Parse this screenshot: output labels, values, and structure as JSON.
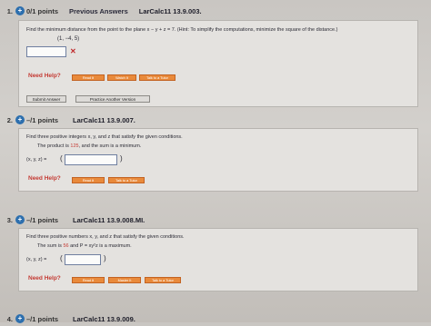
{
  "questions": [
    {
      "number": "1.",
      "points": "0/1 points",
      "previous_answers": "Previous Answers",
      "id": "LarCalc11 13.9.003.",
      "prompt": "Find the minimum distance from the point to the plane x − y + z = 7. (Hint: To simplify the computations, minimize the square of the distance.)",
      "point": "(1, −4, 5)",
      "answer_value": "",
      "wrong_mark": "✕",
      "need_help": "Need Help?",
      "help_buttons": [
        "Read It",
        "Watch It",
        "Talk to a Tutor"
      ],
      "submit": "Submit Answer",
      "practice": "Practice Another Version"
    },
    {
      "number": "2.",
      "points": "–/1 points",
      "id": "LarCalc11 13.9.007.",
      "prompt": "Find three positive integers x, y, and z that satisfy the given conditions.",
      "condition_pre": "The product is ",
      "condition_value": "125",
      "condition_post": ", and the sum is a minimum.",
      "answer_label": "(x, y, z) =",
      "open_paren": "(",
      "close_paren": ")",
      "answer_value": "",
      "need_help": "Need Help?",
      "help_buttons": [
        "Read It",
        "Talk to a Tutor"
      ]
    },
    {
      "number": "3.",
      "points": "–/1 points",
      "id": "LarCalc11 13.9.008.MI.",
      "prompt": "Find three positive numbers x, y, and z that satisfy the given conditions.",
      "condition_pre": "The sum is ",
      "condition_value": "56",
      "condition_post": " and P = xy²z is a maximum.",
      "answer_label": "(x, y, z) =",
      "open_paren": "(",
      "close_paren": ")",
      "answer_value": "",
      "need_help": "Need Help?",
      "help_buttons": [
        "Read It",
        "Master It",
        "Talk to a Tutor"
      ]
    },
    {
      "number": "4.",
      "points": "–/1 points",
      "id": "LarCalc11 13.9.009."
    }
  ],
  "colors": {
    "accent": "#2d6fae",
    "help_button": "#e98a3b",
    "error": "#c0292b"
  }
}
